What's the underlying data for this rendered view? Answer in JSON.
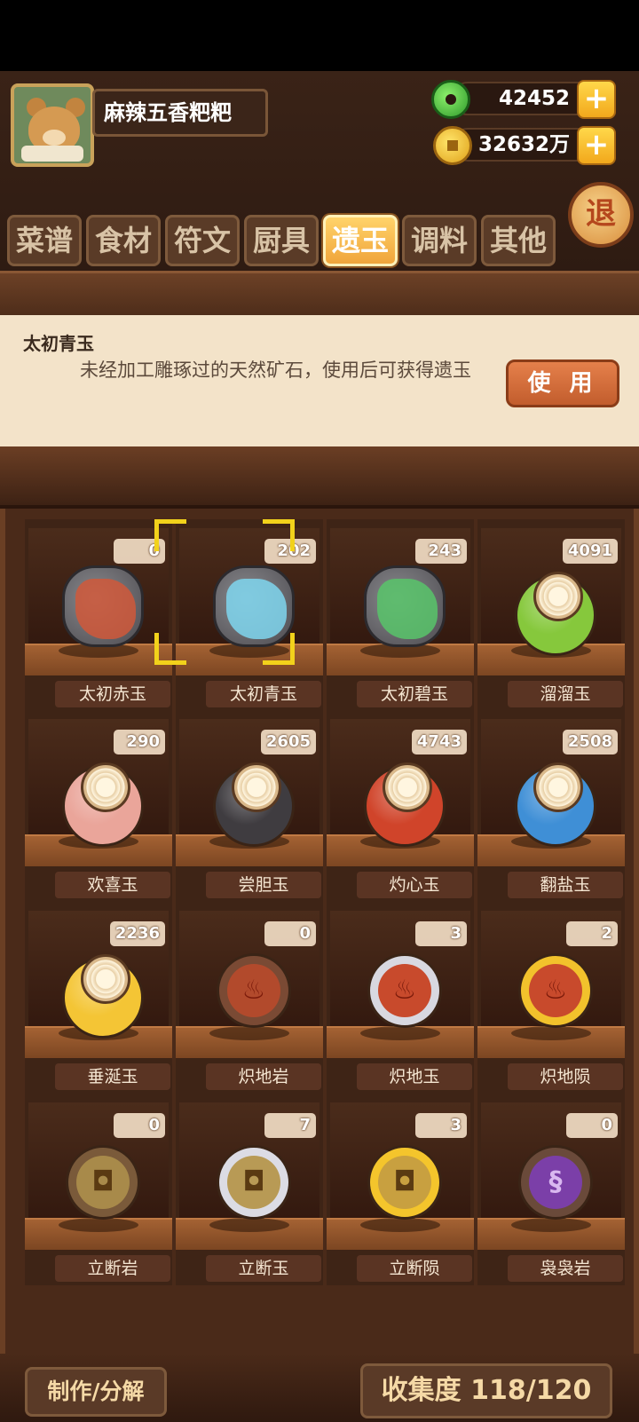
{
  "player": {
    "name": "麻辣五香粑粑"
  },
  "currency": {
    "jade": "42452",
    "coins": "32632万"
  },
  "exit_label": "退",
  "tabs": [
    {
      "label": "菜谱",
      "active": false
    },
    {
      "label": "食材",
      "active": false
    },
    {
      "label": "符文",
      "active": false
    },
    {
      "label": "厨具",
      "active": false
    },
    {
      "label": "遗玉",
      "active": true
    },
    {
      "label": "调料",
      "active": false
    },
    {
      "label": "其他",
      "active": false
    }
  ],
  "selected_item": {
    "name": "太初青玉",
    "description": "未经加工雕琢过的天然矿石，使用后可获得遗玉",
    "use_label": "使 用"
  },
  "items": [
    {
      "name": "太初赤玉",
      "count": "0",
      "icon": "red-ore-icon",
      "color": "#d0583a",
      "kind": "ore"
    },
    {
      "name": "太初青玉",
      "count": "202",
      "icon": "blue-ore-icon",
      "color": "#7fd6ee",
      "kind": "ore",
      "selected": true
    },
    {
      "name": "太初碧玉",
      "count": "243",
      "icon": "green-ore-icon",
      "color": "#58c46a",
      "kind": "ore"
    },
    {
      "name": "溜溜玉",
      "count": "4091",
      "icon": "green-jade-icon",
      "color": "#86c83c",
      "kind": "jade"
    },
    {
      "name": "欢喜玉",
      "count": "290",
      "icon": "pink-jade-icon",
      "color": "#eaa59a",
      "kind": "jade"
    },
    {
      "name": "尝胆玉",
      "count": "2605",
      "icon": "black-jade-icon",
      "color": "#3f3c40",
      "kind": "jade"
    },
    {
      "name": "灼心玉",
      "count": "4743",
      "icon": "red-jade-icon",
      "color": "#d0442a",
      "kind": "jade"
    },
    {
      "name": "翻盐玉",
      "count": "2508",
      "icon": "blue-jade-icon",
      "color": "#3f8fd6",
      "kind": "jade"
    },
    {
      "name": "垂涎玉",
      "count": "2236",
      "icon": "yellow-jade-icon",
      "color": "#f4c535",
      "kind": "jade"
    },
    {
      "name": "炽地岩",
      "count": "0",
      "icon": "fire-rock-icon",
      "color": "#b24a2c",
      "ring": "#7a4a34",
      "kind": "fire"
    },
    {
      "name": "炽地玉",
      "count": "3",
      "icon": "fire-jade-icon",
      "color": "#c84a2c",
      "ring": "#d8d8e0",
      "kind": "fire"
    },
    {
      "name": "炽地陨",
      "count": "2",
      "icon": "fire-meteor-icon",
      "color": "#c84a2c",
      "ring": "#f2c22c",
      "kind": "fire"
    },
    {
      "name": "立断岩",
      "count": "0",
      "icon": "mouth-rock-icon",
      "color": "#a88a4a",
      "ring": "#7a5a3a",
      "kind": "mouth"
    },
    {
      "name": "立断玉",
      "count": "7",
      "icon": "mouth-jade-icon",
      "color": "#b89a55",
      "ring": "#dcdce4",
      "kind": "mouth"
    },
    {
      "name": "立断陨",
      "count": "3",
      "icon": "mouth-meteor-icon",
      "color": "#c8a040",
      "ring": "#f4c52c",
      "kind": "mouth"
    },
    {
      "name": "袅袅岩",
      "count": "0",
      "icon": "smoke-rock-icon",
      "color": "#7b3fa8",
      "ring": "#6a4a3a",
      "kind": "smoke"
    }
  ],
  "bottom": {
    "craft_label": "制作/分解",
    "collection_label": "收集度 118/120"
  }
}
